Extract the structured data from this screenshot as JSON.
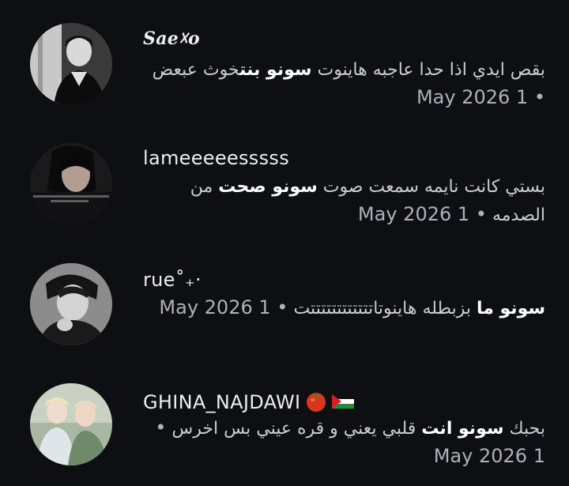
{
  "comments": [
    {
      "username": "Sae☓o",
      "text_before": "بقص ايدي اذا حدا عاجبه هاينوت ",
      "text_bold": "سونو بنت",
      "text_after": "خوث عبعض",
      "timestamp": "• 1 May 2026",
      "avatar_icon": "avatar-bw-portrait"
    },
    {
      "username": "lameeeeesssss",
      "text_before": "بستي كانت نايمه سمعت صوت ",
      "text_bold": "سونو صحت",
      "text_after": " من الصدمه",
      "timestamp": "• 1 May 2026",
      "avatar_icon": "avatar-dark-portrait"
    },
    {
      "username": "rue˚₊·",
      "text_before": "",
      "text_bold": "سونو ما",
      "text_after": " بزبطله هاينوتاتتتتتتتتتتتتت",
      "timestamp": "• 1 May 2026",
      "avatar_icon": "avatar-gray-portrait"
    },
    {
      "username": "GHINA_NAJDAWI",
      "username_emojis": [
        "tomato-icon",
        "palestine-flag-icon"
      ],
      "text_before": "بحبك ",
      "text_bold": "سونو انت",
      "text_after": " قلبي يعني و قره عيني بس اخرس",
      "timestamp": "• 1 May 2026",
      "avatar_icon": "avatar-two-people"
    }
  ],
  "colors": {
    "background": "#0d0f12",
    "username": "#eceef1",
    "text": "#c9ccd1",
    "bold_text": "#ffffff",
    "timestamp": "#aeb2b8"
  }
}
